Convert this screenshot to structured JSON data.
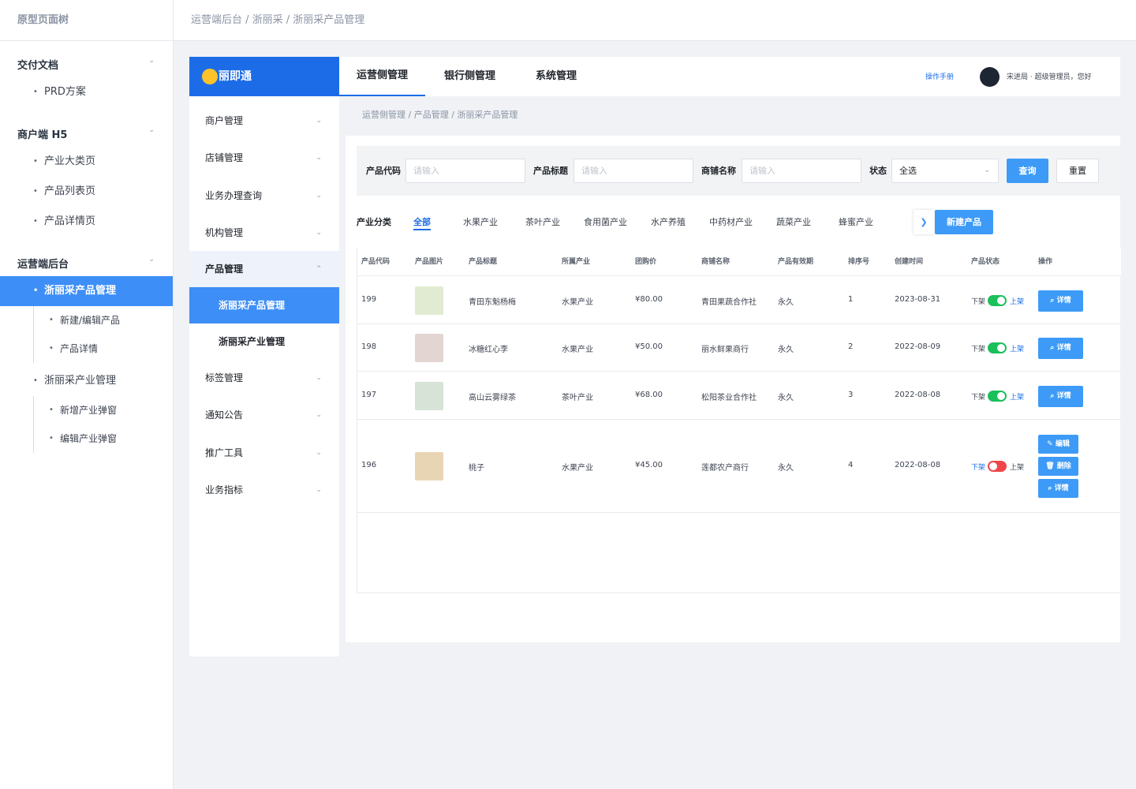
{
  "tree": {
    "title": "原型页面树",
    "sections": [
      {
        "label": "交付文档",
        "items": [
          "PRD方案"
        ]
      },
      {
        "label": "商户端 H5",
        "items": [
          "产业大类页",
          "产品列表页",
          "产品详情页"
        ]
      },
      {
        "label": "运营端后台",
        "items": [
          "浙丽采产品管理",
          "新建/编辑产品",
          "产品详情",
          "浙丽采产业管理",
          "新增产业弹窗",
          "编辑产业弹窗"
        ]
      }
    ]
  },
  "top_breadcrumb": "运营端后台 / 浙丽采 / 浙丽采产品管理",
  "app": {
    "logo": "丽即通",
    "tabs": [
      "运营侧管理",
      "银行侧管理",
      "系统管理"
    ],
    "manual": "操作手册",
    "user": "宋进局 · 超级管理员，您好"
  },
  "menu": {
    "items": [
      "商户管理",
      "店铺管理",
      "业务办理查询",
      "机构管理",
      "产品管理",
      "标签管理",
      "通知公告",
      "推广工具",
      "业务指标"
    ],
    "sub": [
      "浙丽采产品管理",
      "浙丽采产业管理"
    ]
  },
  "inner_breadcrumb": "运营侧管理 / 产品管理 / 浙丽采产品管理",
  "filter": {
    "code_label": "产品代码",
    "title_label": "产品标题",
    "shop_label": "商铺名称",
    "status_label": "状态",
    "placeholder": "请输入",
    "status_value": "全选",
    "query": "查询",
    "reset": "重置"
  },
  "categories": {
    "label": "产业分类",
    "items": [
      "全部",
      "水果产业",
      "茶叶产业",
      "食用菌产业",
      "水产养殖",
      "中药材产业",
      "蔬菜产业",
      "蜂蜜产业"
    ],
    "new_button": "新建产品"
  },
  "table": {
    "headers": [
      "产品代码",
      "产品图片",
      "产品标题",
      "所属产业",
      "团购价",
      "商铺名称",
      "产品有效期",
      "排序号",
      "创建时间",
      "产品状态",
      "操作"
    ],
    "rows": [
      {
        "code": "199",
        "title": "青田东魁杨梅",
        "industry": "水果产业",
        "price": "¥80.00",
        "shop": "青田果蔬合作社",
        "validity": "永久",
        "sort": "1",
        "created": "2023-08-31",
        "on": true,
        "img": "#e1ebd1"
      },
      {
        "code": "198",
        "title": "冰糖红心李",
        "industry": "水果产业",
        "price": "¥50.00",
        "shop": "丽水鲜果商行",
        "validity": "永久",
        "sort": "2",
        "created": "2022-08-09",
        "on": true,
        "img": "#e3d6d2"
      },
      {
        "code": "197",
        "title": "高山云雾绿茶",
        "industry": "茶叶产业",
        "price": "¥68.00",
        "shop": "松阳茶业合作社",
        "validity": "永久",
        "sort": "3",
        "created": "2022-08-08",
        "on": true,
        "img": "#d7e3d7"
      },
      {
        "code": "196",
        "title": "桃子",
        "industry": "水果产业",
        "price": "¥45.00",
        "shop": "莲都农产商行",
        "validity": "永久",
        "sort": "4",
        "created": "2022-08-08",
        "on": false,
        "img": "#e8d5b3"
      }
    ],
    "status_off": "下架",
    "status_on": "上架",
    "detail": "详情",
    "edit": "编辑",
    "delete": "删除"
  },
  "colors": {
    "primary": "#1c6ce8",
    "button": "#3d9bf7",
    "switch_on": "#1bbf5b",
    "switch_off": "#f0464a"
  }
}
